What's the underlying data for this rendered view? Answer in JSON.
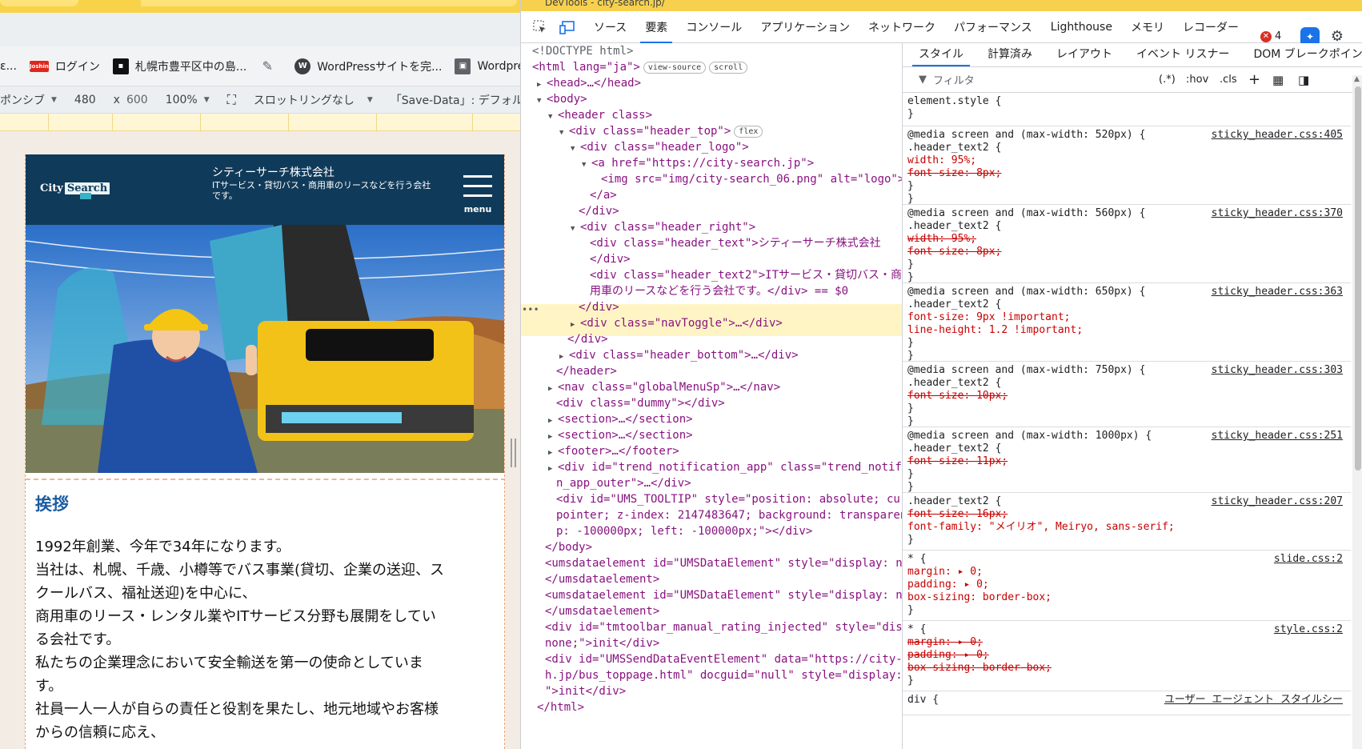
{
  "browser": {
    "bookmarks": [
      {
        "icon": "",
        "label": "ε..."
      },
      {
        "icon": "Joshin",
        "label": "ログイン"
      },
      {
        "icon": "",
        "label": "札幌市豊平区中の島..."
      },
      {
        "icon": "",
        "label": ""
      },
      {
        "icon": "W",
        "label": "WordPressサイトを完..."
      },
      {
        "icon": "",
        "label": "Wordpres"
      }
    ],
    "toolbar": {
      "device": "ポンシブ",
      "width": "480",
      "times": "x",
      "height": "600",
      "zoom": "100%",
      "throttle": "スロットリングなし",
      "savedata": "「Save-Data」: デフォルト"
    }
  },
  "site": {
    "logo_text": "City",
    "logo_text2": "Search",
    "company": "シティーサーチ株式会社",
    "tagline": "ITサービス・貸切バス・商用車のリースなどを行う会社です。",
    "menu": "menu",
    "heading": "挨拶",
    "paragraphs": [
      "1992年創業、今年で34年になります。",
      "当社は、札幌、千歳、小樽等でバス事業(貸切、企業の送迎、ス",
      "クールバス、福祉送迎)を中心に、",
      "商用車のリース・レンタル業やITサービス分野も展開をしてい",
      "る会社です。",
      "私たちの企業理念において安全輸送を第一の使命としていま",
      "す。",
      "社員一人一人が自らの責任と役割を果たし、地元地域やお客様",
      "からの信頼に応え、"
    ]
  },
  "devtools": {
    "title": "DevTools - city-search.jp/",
    "tabs": [
      "ソース",
      "要素",
      "コンソール",
      "アプリケーション",
      "ネットワーク",
      "パフォーマンス",
      "Lighthouse",
      "メモリ",
      "レコーダー"
    ],
    "error_count": "4",
    "tree": [
      {
        "t": "<!DOCTYPE html>"
      },
      {
        "t": "<html lang=\"ja\">",
        "b1": "view-source",
        "b2": "scroll"
      },
      {
        "t": "<head>…</head>"
      },
      {
        "t": "<body>"
      },
      {
        "t": "<header class>"
      },
      {
        "t": "<div class=\"header_top\">",
        "b1": "flex"
      },
      {
        "t": "<div class=\"header_logo\">"
      },
      {
        "t": "<a href=\"https://city-search.jp\">"
      },
      {
        "t": "<img src=\"img/city-search_06.png\" alt=\"logo\">"
      },
      {
        "t": "</a>"
      },
      {
        "t": "</div>"
      },
      {
        "t": "<div class=\"header_right\">"
      },
      {
        "t": "<div class=\"header_text\">シティーサーチ株式会社"
      },
      {
        "t": "</div>"
      },
      {
        "t": "<div class=\"header_text2\">ITサービス・貸切バス・商"
      },
      {
        "t": "用車のリースなどを行う会社です。</div> == $0"
      },
      {
        "t": "</div>"
      },
      {
        "t": "<div class=\"navToggle\">…</div>"
      },
      {
        "t": "</div>"
      },
      {
        "t": "<div class=\"header_bottom\">…</div>"
      },
      {
        "t": "</header>"
      },
      {
        "t": "<nav class=\"globalMenuSp\">…</nav>"
      },
      {
        "t": "<div class=\"dummy\"></div>"
      },
      {
        "t": "<section>…</section>"
      },
      {
        "t": "<section>…</section>"
      },
      {
        "t": "<footer>…</footer>"
      },
      {
        "t": "<div id=\"trend_notification_app\" class=\"trend_notificatio"
      },
      {
        "t": "n_app_outer\">…</div>"
      },
      {
        "t": "<div id=\"UMS_TOOLTIP\" style=\"position: absolute; cursor:"
      },
      {
        "t": "pointer; z-index: 2147483647; background: transparent; to"
      },
      {
        "t": "p: -100000px; left: -100000px;\"></div>"
      },
      {
        "t": "</body>"
      },
      {
        "t": "<umsdataelement id=\"UMSDataElement\" style=\"display: none;\">"
      },
      {
        "t": "</umsdataelement>"
      },
      {
        "t": "<umsdataelement id=\"UMSDataElement\" style=\"display: none;\">"
      },
      {
        "t": "</umsdataelement>"
      },
      {
        "t": "<div id=\"tmtoolbar_manual_rating_injected\" style=\"display:"
      },
      {
        "t": "none;\">init</div>"
      },
      {
        "t": "<div id=\"UMSSendDataEventElement\" data=\"https://city-searc"
      },
      {
        "t": "h.jp/bus_toppage.html\" docguid=\"null\" style=\"display: none;"
      },
      {
        "t": "\">init</div>"
      },
      {
        "t": "</html>"
      }
    ],
    "style_tabs": [
      "スタイル",
      "計算済み",
      "レイアウト",
      "イベント リスナー",
      "DOM ブレークポイント"
    ],
    "filter": "フィルタ",
    "filter_tools": [
      ":hov",
      ".cls"
    ],
    "rules": [
      {
        "lines": [
          "element.style {",
          "}"
        ],
        "src": ""
      },
      {
        "lines": [
          "@media screen and (max-width: 520px) {",
          " .header_text2 {",
          "   width: 95%;",
          "   font-size: 8px;",
          " }",
          "}"
        ],
        "src": "sticky_header.css:405",
        "strike": [
          3
        ]
      },
      {
        "lines": [
          "@media screen and (max-width: 560px) {",
          " .header_text2 {",
          "   width: 95%;",
          "   font-size: 8px;",
          " }",
          "}"
        ],
        "src": "sticky_header.css:370",
        "strike": [
          2,
          3
        ]
      },
      {
        "lines": [
          "@media screen and (max-width: 650px) {",
          " .header_text2 {",
          "   font-size: 9px !important;",
          "   line-height: 1.2 !important;",
          " }",
          "}"
        ],
        "src": "sticky_header.css:363",
        "strike": []
      },
      {
        "lines": [
          "@media screen and (max-width: 750px) {",
          " .header_text2 {",
          "   font-size: 10px;",
          " }",
          "}"
        ],
        "src": "sticky_header.css:303",
        "strike": [
          2
        ]
      },
      {
        "lines": [
          "@media screen and (max-width: 1000px) {",
          " .header_text2 {",
          "   font-size: 11px;",
          " }",
          "}"
        ],
        "src": "sticky_header.css:251",
        "strike": [
          2
        ]
      },
      {
        "lines": [
          ".header_text2 {",
          "  font-size: 16px;",
          "  font-family: \"メイリオ\", Meiryo, sans-serif;",
          "}"
        ],
        "src": "sticky_header.css:207",
        "strike": [
          1
        ]
      },
      {
        "lines": [
          "* {",
          "  margin: ▸ 0;",
          "  padding: ▸ 0;",
          "  box-sizing: border-box;",
          "}"
        ],
        "src": "slide.css:2",
        "strike": []
      },
      {
        "lines": [
          "* {",
          "  margin: ▸ 0;",
          "  padding: ▸ 0;",
          "  box-sizing: border-box;",
          "}"
        ],
        "src": "style.css:2",
        "strike": [
          1,
          2,
          3
        ]
      },
      {
        "lines": [
          "div {"
        ],
        "src": "ユーザー エージェント スタイルシー"
      }
    ]
  }
}
